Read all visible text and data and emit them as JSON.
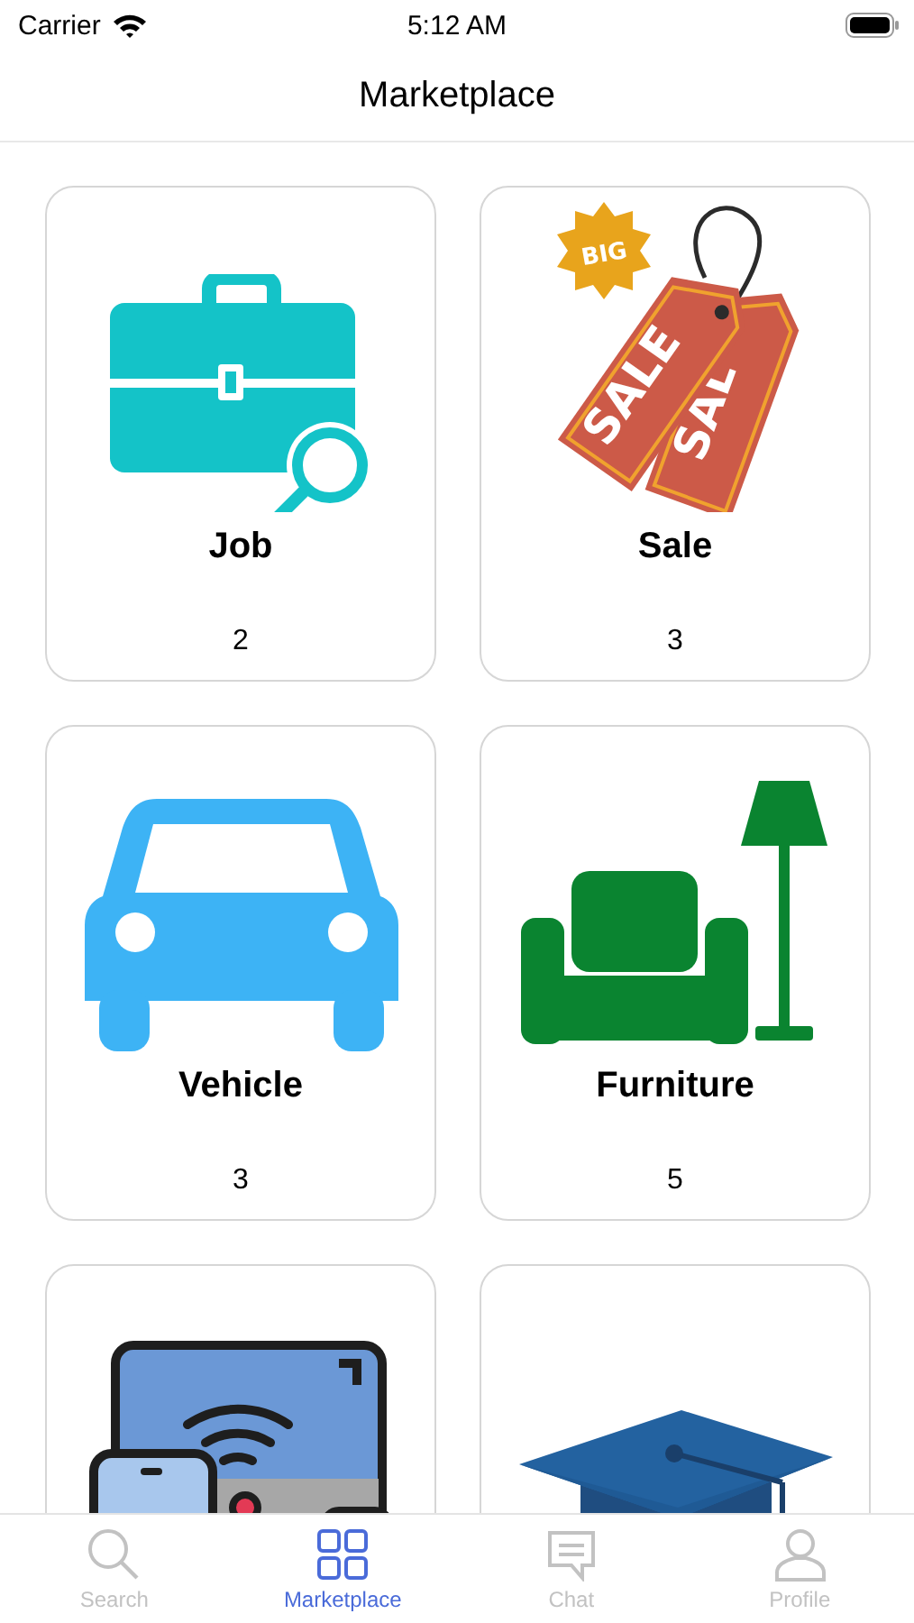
{
  "status_bar": {
    "carrier": "Carrier",
    "time": "5:12 AM"
  },
  "nav": {
    "title": "Marketplace"
  },
  "categories": [
    {
      "kind": "briefcase",
      "title": "Job",
      "count": "2"
    },
    {
      "kind": "tags",
      "title": "Sale",
      "count": "3",
      "badge_text": "BIG",
      "tag_texts": [
        "SALE",
        "SAL"
      ]
    },
    {
      "kind": "car",
      "title": "Vehicle",
      "count": "3"
    },
    {
      "kind": "furniture",
      "title": "Furniture",
      "count": "5"
    },
    {
      "kind": "devices"
    },
    {
      "kind": "cap"
    }
  ],
  "tab_bar": [
    {
      "kind": "search",
      "label": "Search",
      "selected": false
    },
    {
      "kind": "grid",
      "label": "Marketplace",
      "selected": true
    },
    {
      "kind": "chat",
      "label": "Chat",
      "selected": false
    },
    {
      "kind": "profile",
      "label": "Profile",
      "selected": false
    }
  ]
}
